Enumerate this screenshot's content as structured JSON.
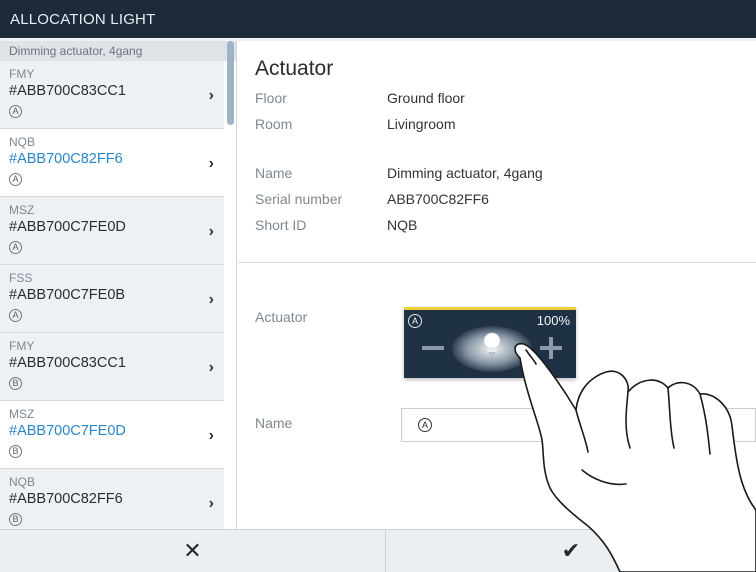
{
  "window": {
    "title": "ALLOCATION LIGHT"
  },
  "sidebar": {
    "header": "Dimming actuator, 4gang",
    "items": [
      {
        "short": "FMY",
        "serial": "#ABB700C83CC1",
        "channel": "A",
        "selected": false
      },
      {
        "short": "NQB",
        "serial": "#ABB700C82FF6",
        "channel": "A",
        "selected": true
      },
      {
        "short": "MSZ",
        "serial": "#ABB700C7FE0D",
        "channel": "A",
        "selected": false
      },
      {
        "short": "FSS",
        "serial": "#ABB700C7FE0B",
        "channel": "A",
        "selected": false
      },
      {
        "short": "FMY",
        "serial": "#ABB700C83CC1",
        "channel": "B",
        "selected": false
      },
      {
        "short": "MSZ",
        "serial": "#ABB700C7FE0D",
        "channel": "B",
        "selected": true
      },
      {
        "short": "NQB",
        "serial": "#ABB700C82FF6",
        "channel": "B",
        "selected": false
      }
    ]
  },
  "detail": {
    "title": "Actuator",
    "floor_label": "Floor",
    "floor_value": "Ground floor",
    "room_label": "Room",
    "room_value": "Livingroom",
    "name_label": "Name",
    "name_value": "Dimming actuator, 4gang",
    "serial_label": "Serial number",
    "serial_value": "ABB700C82FF6",
    "shortid_label": "Short ID",
    "shortid_value": "NQB",
    "actuator_label": "Actuator",
    "tile": {
      "channel": "A",
      "percent": "100%",
      "level": 1.0
    },
    "name_field_label": "Name",
    "name_field_channel": "A"
  },
  "footer": {
    "cancel_icon": "✕",
    "confirm_icon": "✔"
  },
  "colors": {
    "titlebar": "#1c2a3a",
    "accent_blue": "#2a86c8",
    "tile_bg": "#1f3144",
    "tile_top": "#e9d23a"
  }
}
